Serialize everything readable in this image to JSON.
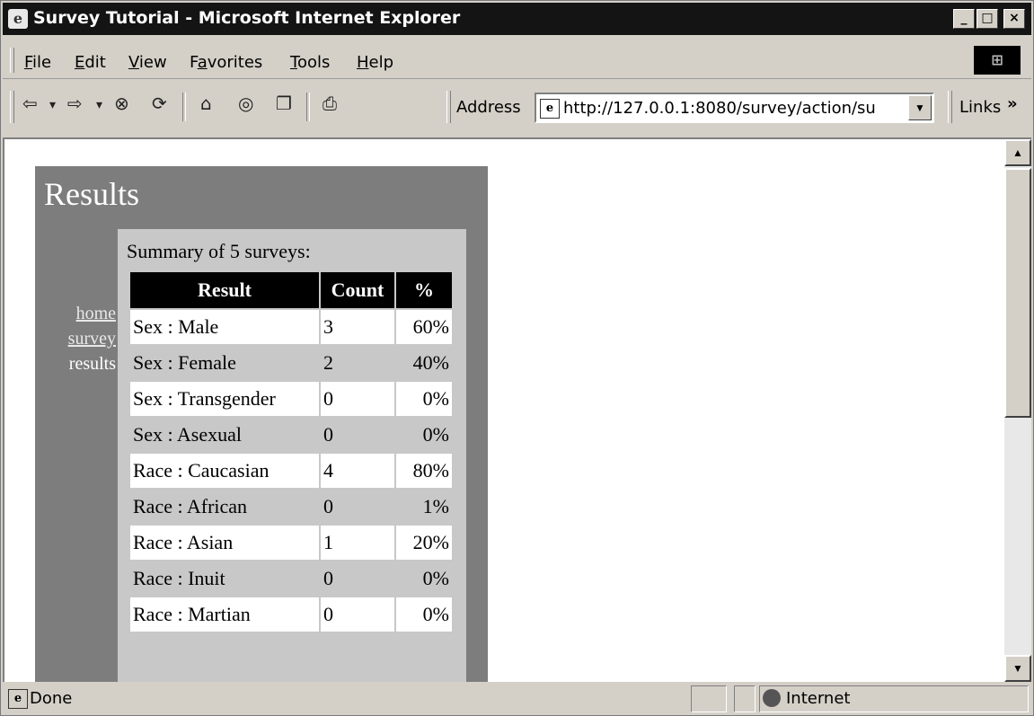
{
  "window": {
    "title": "Survey Tutorial - Microsoft Internet Explorer",
    "controls": [
      "_",
      "□",
      "×"
    ]
  },
  "menubar": {
    "items": [
      {
        "label": "File",
        "underline": "F"
      },
      {
        "label": "Edit",
        "underline": "E"
      },
      {
        "label": "View",
        "underline": "V"
      },
      {
        "label": "Favorites",
        "underline": "a"
      },
      {
        "label": "Tools",
        "underline": "T"
      },
      {
        "label": "Help",
        "underline": "H"
      }
    ]
  },
  "toolbar": {
    "back": "⇦",
    "back_dd": "▾",
    "forward": "⇨",
    "forward_dd": "▾",
    "stop": "⊗",
    "refresh": "⟳",
    "home": "⌂",
    "search": "◎",
    "favorites": "❐",
    "print": "⎙",
    "address_label": "Address",
    "address_value": "http://127.0.0.1:8080/survey/action/su",
    "links_label": "Links",
    "links_chevron": "»"
  },
  "page": {
    "heading": "Results",
    "nav": {
      "home": "home",
      "survey": "survey",
      "results": "results"
    },
    "summary": "Summary of 5 surveys:",
    "table": {
      "headers": [
        "Result",
        "Count",
        "%"
      ],
      "rows": [
        {
          "result": "Sex : Male",
          "count": "3",
          "pct": "60%"
        },
        {
          "result": "Sex : Female",
          "count": "2",
          "pct": "40%"
        },
        {
          "result": "Sex : Transgender",
          "count": "0",
          "pct": "0%"
        },
        {
          "result": "Sex : Asexual",
          "count": "0",
          "pct": "0%"
        },
        {
          "result": "Race : Caucasian",
          "count": "4",
          "pct": "80%"
        },
        {
          "result": "Race : African",
          "count": "0",
          "pct": "1%"
        },
        {
          "result": "Race : Asian",
          "count": "1",
          "pct": "20%"
        },
        {
          "result": "Race : Inuit",
          "count": "0",
          "pct": "0%"
        },
        {
          "result": "Race : Martian",
          "count": "0",
          "pct": "0%"
        }
      ]
    }
  },
  "statusbar": {
    "text": "Done",
    "zone": "Internet"
  }
}
